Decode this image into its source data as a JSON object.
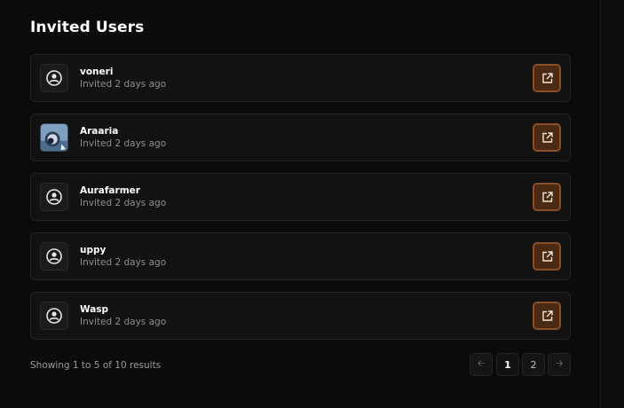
{
  "section": {
    "title": "Invited Users"
  },
  "users": [
    {
      "name": "voneri",
      "status": "Invited 2 days ago",
      "avatar": "default-user-icon"
    },
    {
      "name": "Araaria",
      "status": "Invited 2 days ago",
      "avatar": "profile-photo"
    },
    {
      "name": "Aurafarmer",
      "status": "Invited 2 days ago",
      "avatar": "default-user-icon"
    },
    {
      "name": "uppy",
      "status": "Invited 2 days ago",
      "avatar": "default-user-icon"
    },
    {
      "name": "Wasp",
      "status": "Invited 2 days ago",
      "avatar": "default-user-icon"
    }
  ],
  "footer": {
    "summary": "Showing 1 to 5 of 10 results"
  },
  "pagination": {
    "prev_icon": "arrow-left-icon",
    "pages": [
      "1",
      "2"
    ],
    "current": "1",
    "next_icon": "arrow-right-icon"
  },
  "colors": {
    "background": "#0b0b0b",
    "card": "#121212",
    "accent_button": "#4a2a12",
    "accent_border": "#8a4f26"
  }
}
